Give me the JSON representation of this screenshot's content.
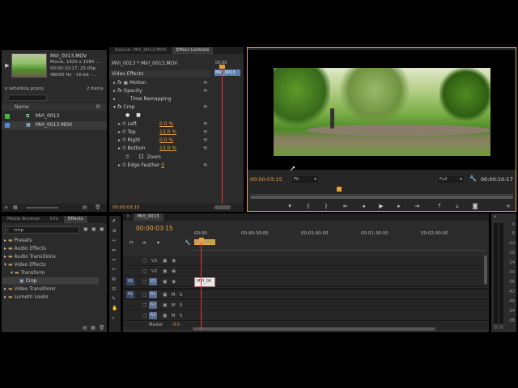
{
  "project": {
    "clip_name": "MVI_0013.MOV",
    "clip_info1": "Movie, 1920 x 1080 ...",
    "clip_info2": "00:00:10:17, 25.00p",
    "clip_info3": "48000 Hz - 16-bit -...",
    "project_file": "o letterbox.prproj",
    "item_count": "2 Items",
    "search_placeholder": "",
    "col_name": "Name",
    "col_fr": "Fr",
    "items": [
      {
        "label": "MVI_0013",
        "color": "#3bbd3b"
      },
      {
        "label": "MVI_0013.MOV",
        "color": "#4b8fd6"
      }
    ]
  },
  "effect_controls": {
    "tabs": [
      "Source: MVI_0013.MOV",
      "Effect Controls"
    ],
    "clip_path": "MVI_0013 * MVI_0013.MOV",
    "mini_time": "00:00",
    "clip_chip": "MVI_0013",
    "section": "Video Effects",
    "motion": "Motion",
    "opacity": "Opacity",
    "time_remap": "Time Remapping",
    "crop": "Crop",
    "params": [
      {
        "name": "Left",
        "value": "0.0 %"
      },
      {
        "name": "Top",
        "value": "13.0 %"
      },
      {
        "name": "Right",
        "value": "0.0 %"
      },
      {
        "name": "Bottom",
        "value": "13.0 %"
      }
    ],
    "zoom": "Zoom",
    "edge_feather": "Edge Feather",
    "edge_value": "0",
    "timecode": "00:00:03:15"
  },
  "program": {
    "timecode": "00:00:03:15",
    "fit": "Fit",
    "quality": "Full",
    "duration": "00:00:10:17"
  },
  "effects": {
    "tabs": [
      "Media Browser",
      "Info",
      "Effects"
    ],
    "search_value": "crop",
    "tree": [
      {
        "label": "Presets",
        "level": 0
      },
      {
        "label": "Audio Effects",
        "level": 0
      },
      {
        "label": "Audio Transitions",
        "level": 0
      },
      {
        "label": "Video Effects",
        "level": 0
      },
      {
        "label": "Transform",
        "level": 1
      },
      {
        "label": "Crop",
        "level": 2
      },
      {
        "label": "Video Transitions",
        "level": 0
      },
      {
        "label": "Lumetri Looks",
        "level": 0
      }
    ]
  },
  "timeline": {
    "tab": "00:00:03:15",
    "seq_tab": "MVI_0013",
    "timecode": "00:00:03:15",
    "ruler": [
      "00:00",
      "00:00:30:00",
      "00:01:00:00",
      "00:01:30:00",
      "00:02:00:00"
    ],
    "video_tracks": [
      "V3",
      "V2",
      "V1"
    ],
    "audio_tracks": [
      "A1",
      "A2",
      "A3"
    ],
    "source_v": "V1",
    "source_a": "A1",
    "clip_label": "MVI_00",
    "master": "Master",
    "master_val": "0.0"
  },
  "meter": {
    "ticks": [
      "0",
      "-6",
      "-12",
      "-18",
      "-24",
      "-30",
      "-36",
      "-42",
      "-48",
      "-54",
      "dB"
    ]
  }
}
